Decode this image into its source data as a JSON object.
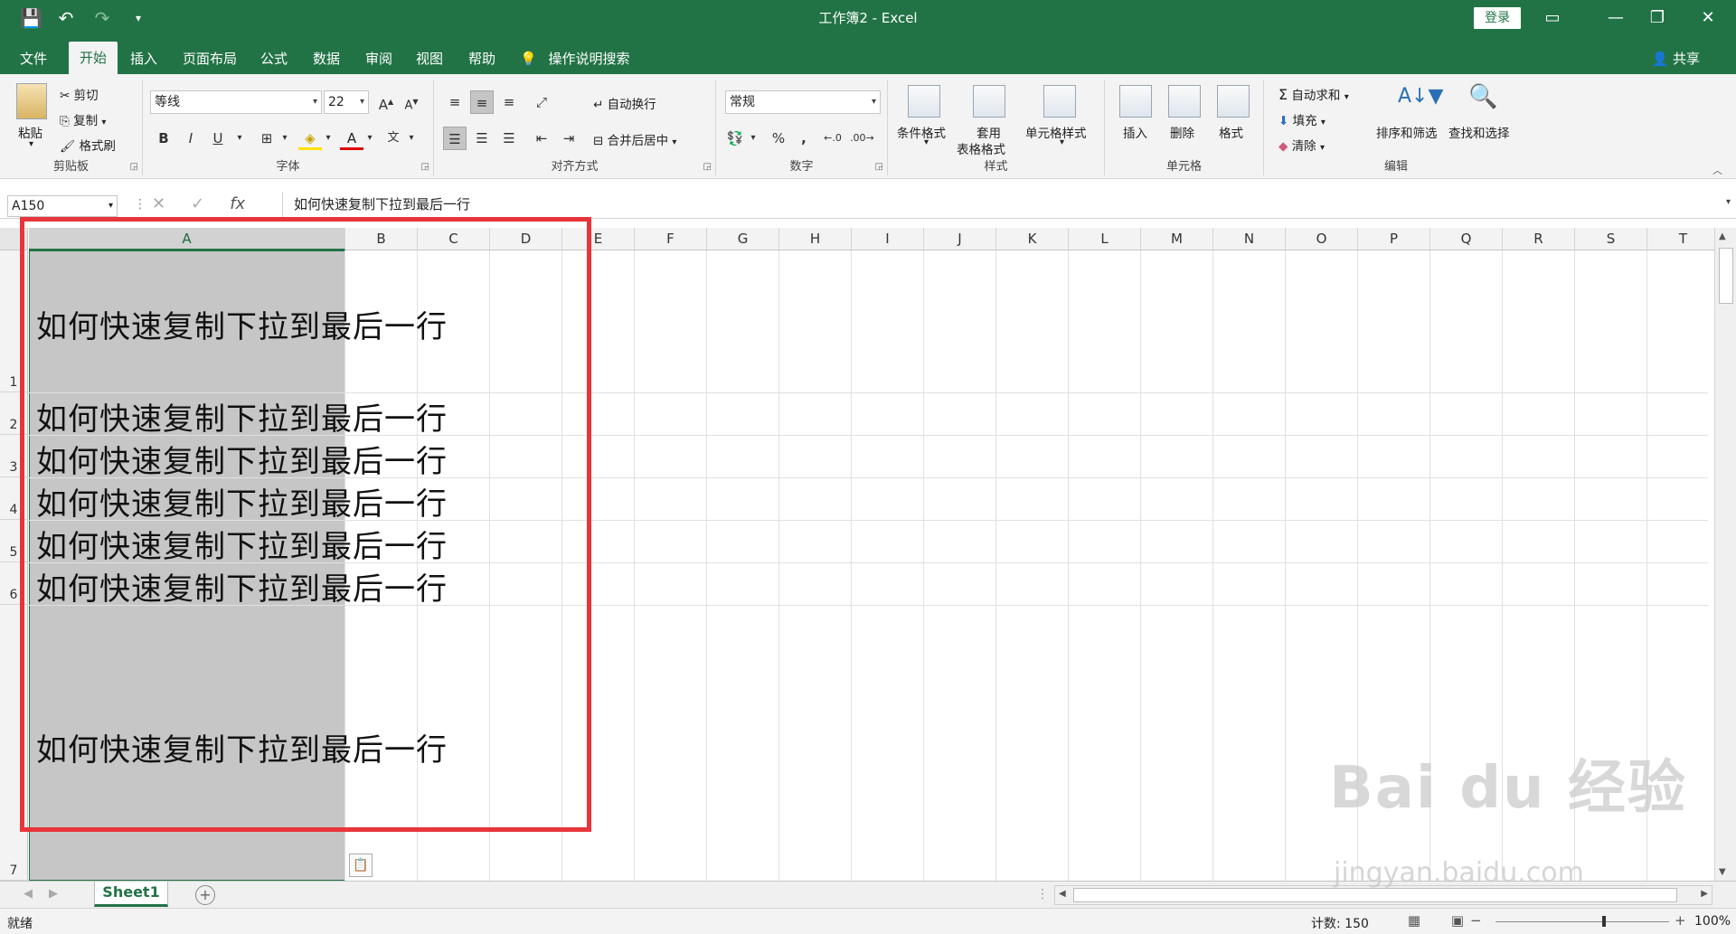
{
  "app": {
    "title": "工作簿2  -  Excel",
    "login": "登录",
    "accent": "#217346"
  },
  "quick_access": [
    "save-icon",
    "undo-icon",
    "redo-icon",
    "customize-icon"
  ],
  "tabs": [
    "文件",
    "开始",
    "插入",
    "页面布局",
    "公式",
    "数据",
    "审阅",
    "视图",
    "帮助"
  ],
  "active_tab": "开始",
  "tell_me": "操作说明搜索",
  "share": "共享",
  "ribbon": {
    "clipboard": {
      "label": "剪贴板",
      "paste": "粘贴",
      "cut": "剪切",
      "copy": "复制",
      "format_painter": "格式刷"
    },
    "font": {
      "label": "字体",
      "name": "等线",
      "size": "22",
      "bold": "B",
      "italic": "I",
      "underline": "U",
      "grow": "A",
      "shrink": "A",
      "font_color": "A",
      "phonetic": "文"
    },
    "alignment": {
      "label": "对齐方式",
      "wrap": "自动换行",
      "merge": "合并后居中"
    },
    "number": {
      "label": "数字",
      "format": "常规",
      "percent": "%",
      "comma": ","
    },
    "styles": {
      "label": "样式",
      "conditional": "条件格式",
      "table1": "套用",
      "table2": "表格格式",
      "cell_styles": "单元格样式"
    },
    "cells": {
      "label": "单元格",
      "insert": "插入",
      "delete": "删除",
      "format": "格式"
    },
    "editing": {
      "label": "编辑",
      "autosum": "自动求和",
      "fill": "填充",
      "clear": "清除",
      "sort": "排序和筛选",
      "find": "查找和选择"
    }
  },
  "formula_bar": {
    "name_box": "A150",
    "fx": "fx",
    "content": "如何快速复制下拉到最后一行"
  },
  "columns": [
    "A",
    "B",
    "C",
    "D",
    "E",
    "F",
    "G",
    "H",
    "I",
    "J",
    "K",
    "L",
    "M",
    "N",
    "O",
    "P",
    "Q",
    "R",
    "S",
    "T"
  ],
  "selected_column": "A",
  "rows": [
    "1",
    "2",
    "3",
    "4",
    "5",
    "6",
    "7"
  ],
  "cells": {
    "a1": "如何快速复制下拉到最后一行",
    "a2": "如何快速复制下拉到最后一行",
    "a3": "如何快速复制下拉到最后一行",
    "a4": "如何快速复制下拉到最后一行",
    "a5": "如何快速复制下拉到最后一行",
    "a6": "如何快速复制下拉到最后一行",
    "a7": "如何快速复制下拉到最后一行"
  },
  "sheet_tab": "Sheet1",
  "status": {
    "ready": "就绪",
    "count": "计数: 150",
    "zoom": "100%",
    "minus": "−",
    "plus": "+"
  },
  "watermark": {
    "brand": "Bai du 经验",
    "url": "jingyan.baidu.com"
  }
}
